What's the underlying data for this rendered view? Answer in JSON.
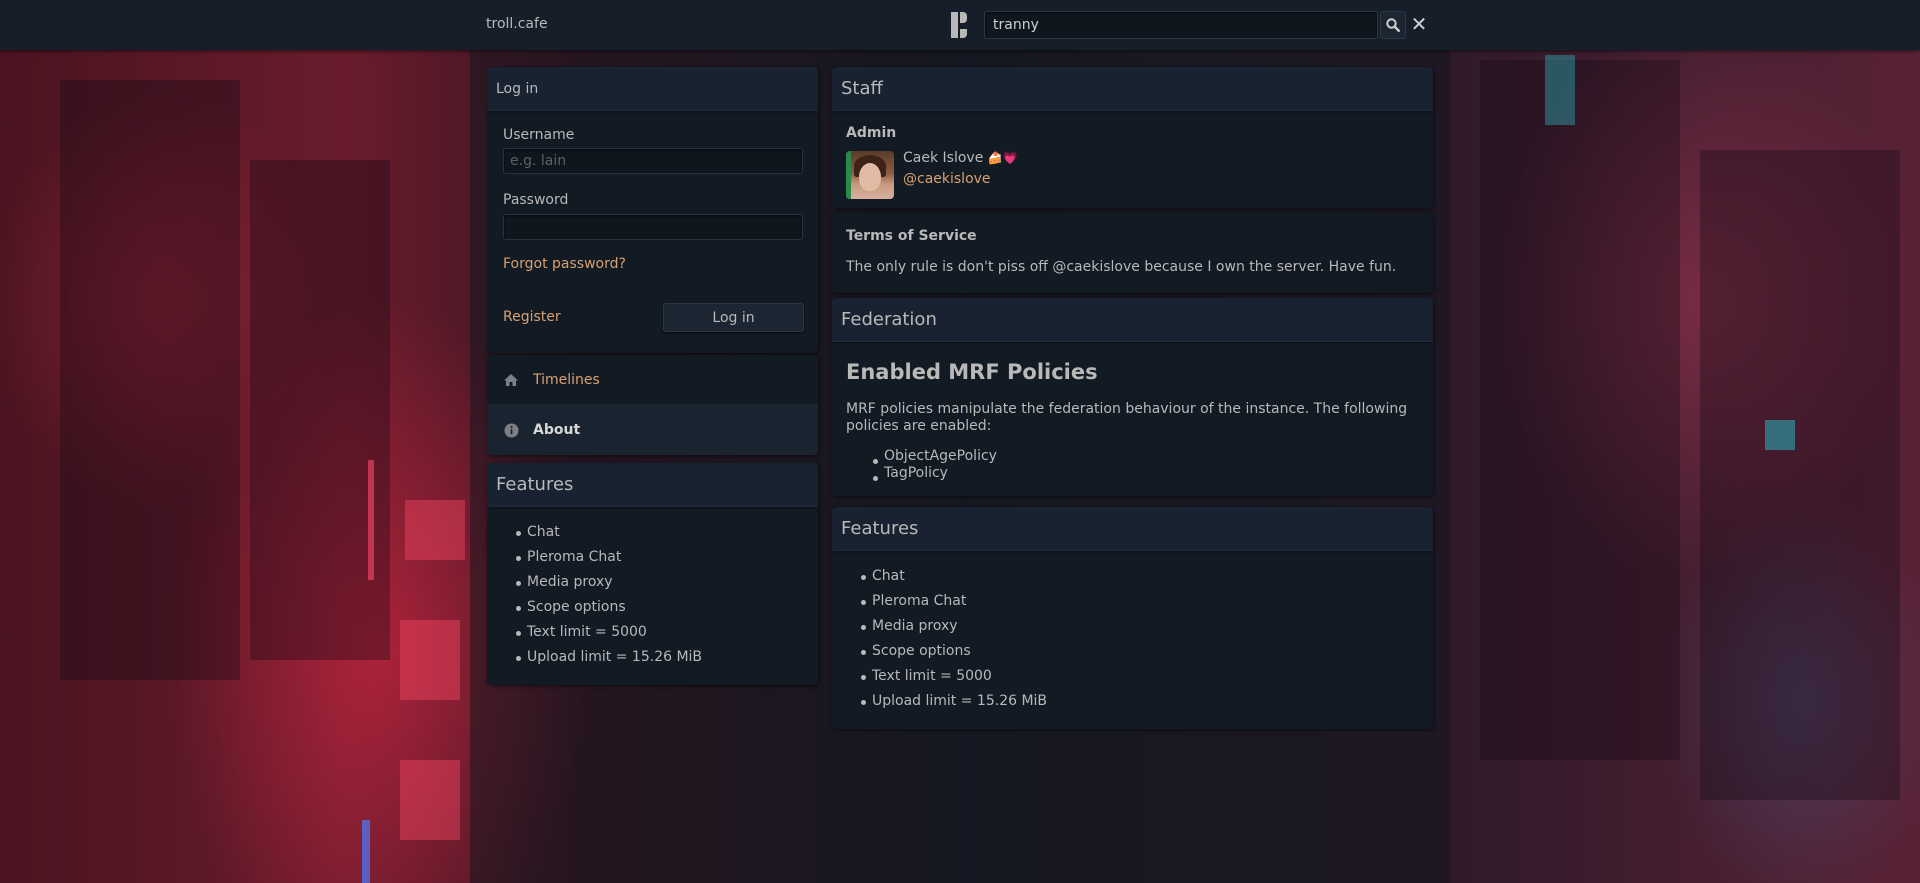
{
  "topbar": {
    "instance_name": "troll.cafe",
    "search_value": "tranny"
  },
  "login": {
    "heading": "Log in",
    "username_label": "Username",
    "username_placeholder": "e.g. lain",
    "password_label": "Password",
    "forgot_label": "Forgot password?",
    "register_label": "Register",
    "login_button": "Log in"
  },
  "nav": {
    "items": [
      {
        "label": "Timelines",
        "icon": "home-icon"
      },
      {
        "label": "About",
        "icon": "info-icon"
      }
    ]
  },
  "features_left": {
    "heading": "Features",
    "items": [
      "Chat",
      "Pleroma Chat",
      "Media proxy",
      "Scope options",
      "Text limit = 5000",
      "Upload limit = 15.26 MiB"
    ]
  },
  "staff": {
    "heading": "Staff",
    "role": "Admin",
    "display_name": "Caek Islove",
    "emojis": "🍰💗",
    "handle": "@caekislove"
  },
  "tos": {
    "heading": "Terms of Service",
    "text": "The only rule is don't piss off @caekislove because I own the server. Have fun."
  },
  "federation": {
    "heading": "Federation",
    "subheading": "Enabled MRF Policies",
    "description": "MRF policies manipulate the federation behaviour of the instance. The following policies are enabled:",
    "policies": [
      "ObjectAgePolicy",
      "TagPolicy"
    ]
  },
  "features_right": {
    "heading": "Features",
    "items": [
      "Chat",
      "Pleroma Chat",
      "Media proxy",
      "Scope options",
      "Text limit = 5000",
      "Upload limit = 15.26 MiB"
    ]
  },
  "colors": {
    "link": "#d8a070",
    "panel": "#121a24",
    "heading": "#182230",
    "topbar": "#161e29"
  }
}
